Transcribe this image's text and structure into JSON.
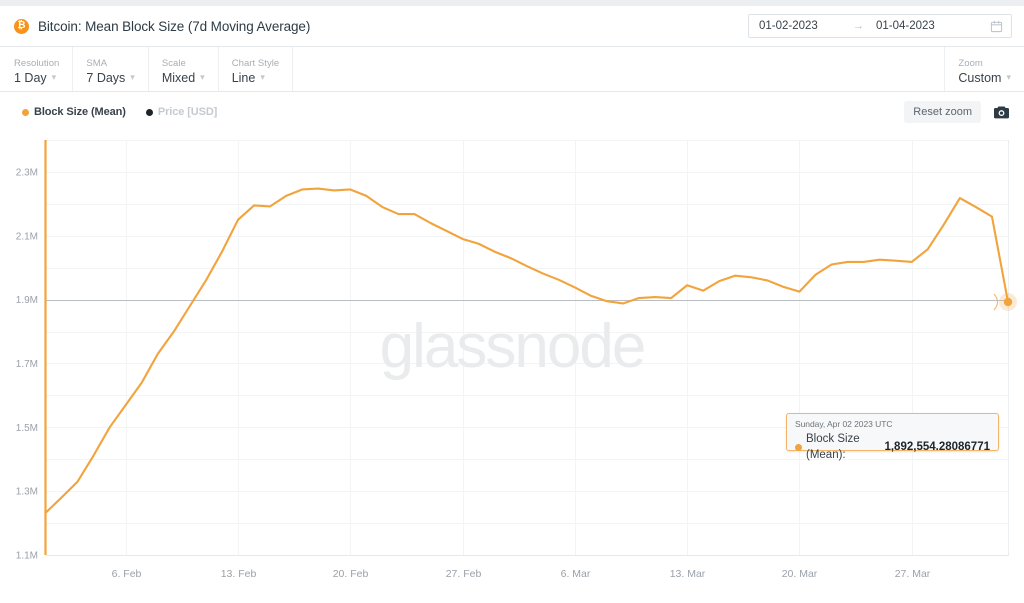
{
  "header": {
    "icon": "bitcoin-icon",
    "icon_glyph": "₿",
    "title": "Bitcoin: Mean Block Size (7d Moving Average)",
    "date_range": {
      "start": "01-02-2023",
      "arrow": "→",
      "end": "01-04-2023",
      "calendar_icon": "calendar-icon"
    }
  },
  "toolbar": {
    "items": [
      {
        "label": "Resolution",
        "value": "1 Day"
      },
      {
        "label": "SMA",
        "value": "7 Days"
      },
      {
        "label": "Scale",
        "value": "Mixed"
      },
      {
        "label": "Chart Style",
        "value": "Line"
      }
    ],
    "zoom": {
      "label": "Zoom",
      "value": "Custom"
    }
  },
  "legend": {
    "items": [
      {
        "label": "Block Size (Mean)",
        "color": "#f2a33c",
        "active": true
      },
      {
        "label": "Price [USD]",
        "color": "#1d252b",
        "active": false
      }
    ],
    "reset_zoom": "Reset zoom",
    "camera_icon": "camera-icon"
  },
  "tooltip": {
    "date": "Sunday, Apr 02 2023 UTC",
    "series_label": "Block Size (Mean):",
    "value": "1,892,554.28086771",
    "dot_color": "#f2a33c"
  },
  "watermark": "glassnode",
  "chart_data": {
    "type": "line",
    "title": "Bitcoin: Mean Block Size (7d Moving Average)",
    "xlabel": "",
    "ylabel": "",
    "grid": true,
    "legend_position": "top-left",
    "line_color": "#f2a33c",
    "ylim": [
      1100000,
      2400000
    ],
    "ytick_labels": [
      "2.3M",
      "2.1M",
      "1.9M",
      "1.7M",
      "1.5M",
      "1.3M",
      "1.1M"
    ],
    "ytick_values": [
      2300000,
      2100000,
      1900000,
      1700000,
      1500000,
      1300000,
      1100000
    ],
    "xtick_labels": [
      "6. Feb",
      "13. Feb",
      "20. Feb",
      "27. Feb",
      "6. Mar",
      "13. Mar",
      "20. Mar",
      "27. Mar"
    ],
    "xtick_dates": [
      "2023-02-06",
      "2023-02-13",
      "2023-02-20",
      "2023-02-27",
      "2023-03-06",
      "2023-03-13",
      "2023-03-20",
      "2023-03-27"
    ],
    "x_start": "2023-02-01",
    "x_end": "2023-04-02",
    "highlight_line": 1900000,
    "series": [
      {
        "name": "Block Size (Mean)",
        "color": "#f2a33c",
        "x": [
          "2023-02-01",
          "2023-02-02",
          "2023-02-03",
          "2023-02-04",
          "2023-02-05",
          "2023-02-06",
          "2023-02-07",
          "2023-02-08",
          "2023-02-09",
          "2023-02-10",
          "2023-02-11",
          "2023-02-12",
          "2023-02-13",
          "2023-02-14",
          "2023-02-15",
          "2023-02-16",
          "2023-02-17",
          "2023-02-18",
          "2023-02-19",
          "2023-02-20",
          "2023-02-21",
          "2023-02-22",
          "2023-02-23",
          "2023-02-24",
          "2023-02-25",
          "2023-02-26",
          "2023-02-27",
          "2023-02-28",
          "2023-03-01",
          "2023-03-02",
          "2023-03-03",
          "2023-03-04",
          "2023-03-05",
          "2023-03-06",
          "2023-03-07",
          "2023-03-08",
          "2023-03-09",
          "2023-03-10",
          "2023-03-11",
          "2023-03-12",
          "2023-03-13",
          "2023-03-14",
          "2023-03-15",
          "2023-03-16",
          "2023-03-17",
          "2023-03-18",
          "2023-03-19",
          "2023-03-20",
          "2023-03-21",
          "2023-03-22",
          "2023-03-23",
          "2023-03-24",
          "2023-03-25",
          "2023-03-26",
          "2023-03-27",
          "2023-03-28",
          "2023-03-29",
          "2023-03-30",
          "2023-03-31",
          "2023-04-01",
          "2023-04-02"
        ],
        "values": [
          1232000,
          1280000,
          1330000,
          1412000,
          1500000,
          1570000,
          1640000,
          1730000,
          1800000,
          1880000,
          1960000,
          2050000,
          2150000,
          2195000,
          2192000,
          2225000,
          2245000,
          2248000,
          2242000,
          2245000,
          2225000,
          2190000,
          2168000,
          2168000,
          2140000,
          2115000,
          2090000,
          2075000,
          2050000,
          2030000,
          2005000,
          1982000,
          1962000,
          1938000,
          1912000,
          1895000,
          1888000,
          1905000,
          1908000,
          1905000,
          1945000,
          1928000,
          1958000,
          1975000,
          1970000,
          1960000,
          1940000,
          1925000,
          1978000,
          2010000,
          2018000,
          2018000,
          2025000,
          2022000,
          2018000,
          2058000,
          2135000,
          2218000,
          2190000,
          2160000,
          1892554.28086771
        ]
      }
    ],
    "last_point": {
      "date": "2023-04-02",
      "value": 1892554.28086771
    }
  }
}
